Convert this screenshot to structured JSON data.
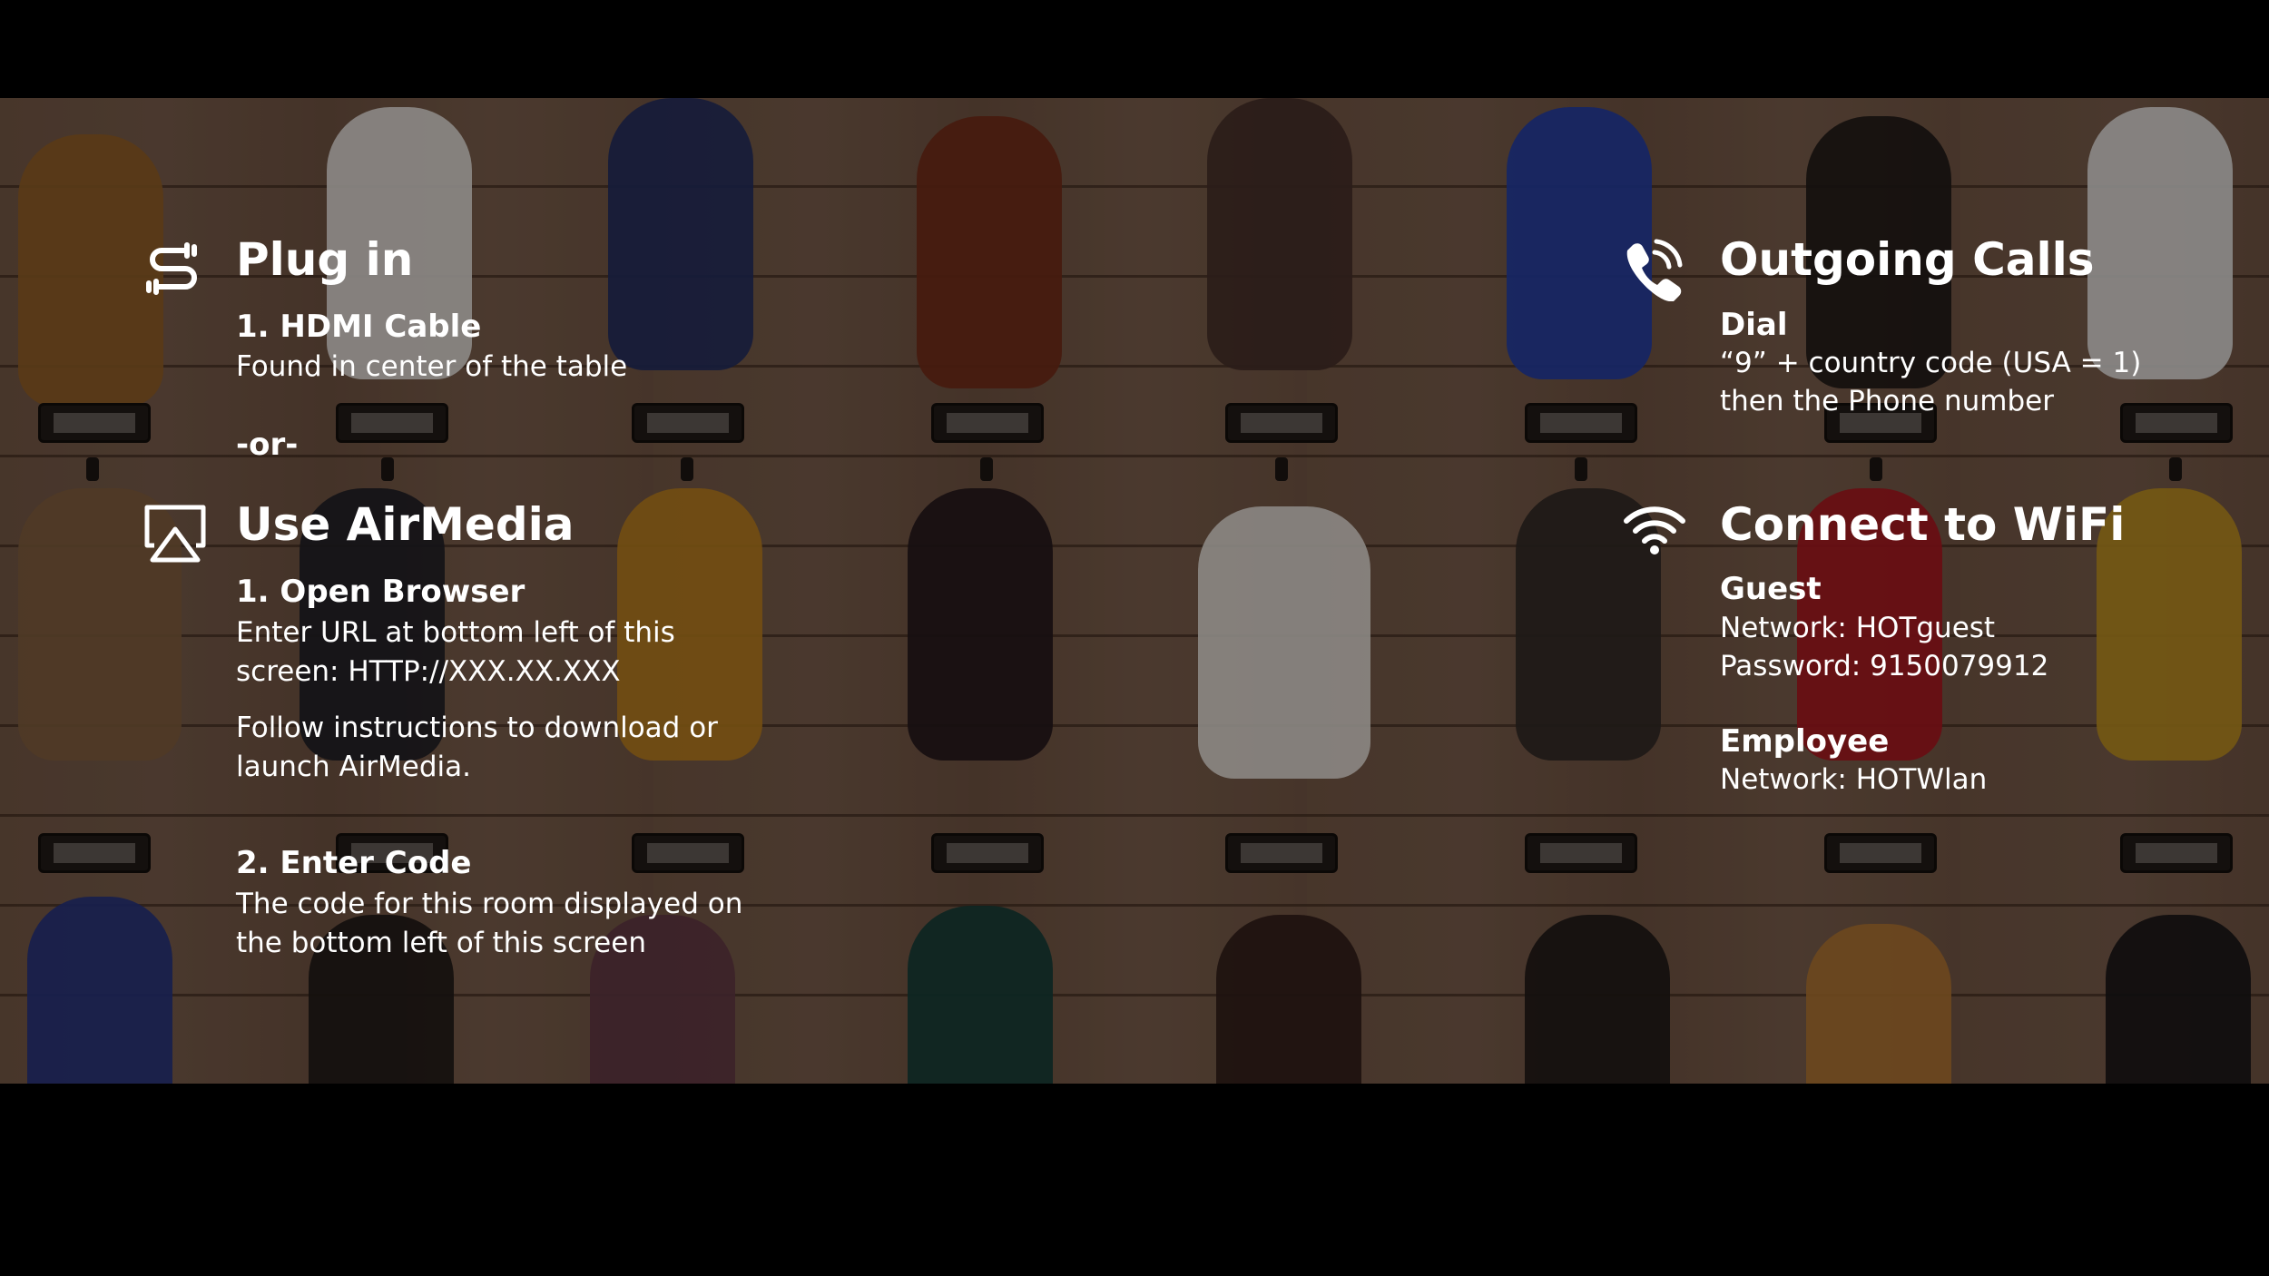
{
  "plug_in": {
    "icon": "plug-icon",
    "title": "Plug in",
    "step1_title": "1. HDMI Cable",
    "step1_text": "Found in center of the table",
    "separator": "-or-"
  },
  "airmedia": {
    "icon": "airplay-icon",
    "title": "Use AirMedia",
    "step1_title": "1. Open Browser",
    "step1_line1": "Enter URL at bottom left of this",
    "step1_line2": "screen: HTTP://XXX.XX.XXX",
    "step1_line3": "Follow instructions to download or",
    "step1_line4": "launch AirMedia.",
    "step2_title": "2. Enter Code",
    "step2_line1": "The code for this room displayed on",
    "step2_line2": "the bottom left of this screen"
  },
  "calls": {
    "icon": "phone-icon",
    "title": "Outgoing Calls",
    "sub_title": "Dial",
    "line1": "“9” + country code (USA = 1)",
    "line2": "then the Phone number"
  },
  "wifi": {
    "icon": "wifi-icon",
    "title": "Connect to WiFi",
    "guest_title": "Guest",
    "guest_network": "Network: HOTguest",
    "guest_password": "Password: 9150079912",
    "employee_title": "Employee",
    "employee_network": "Network: HOTWlan"
  },
  "colors": {
    "background": "#000000",
    "text": "#ffffff",
    "wood": "#6d5442"
  }
}
